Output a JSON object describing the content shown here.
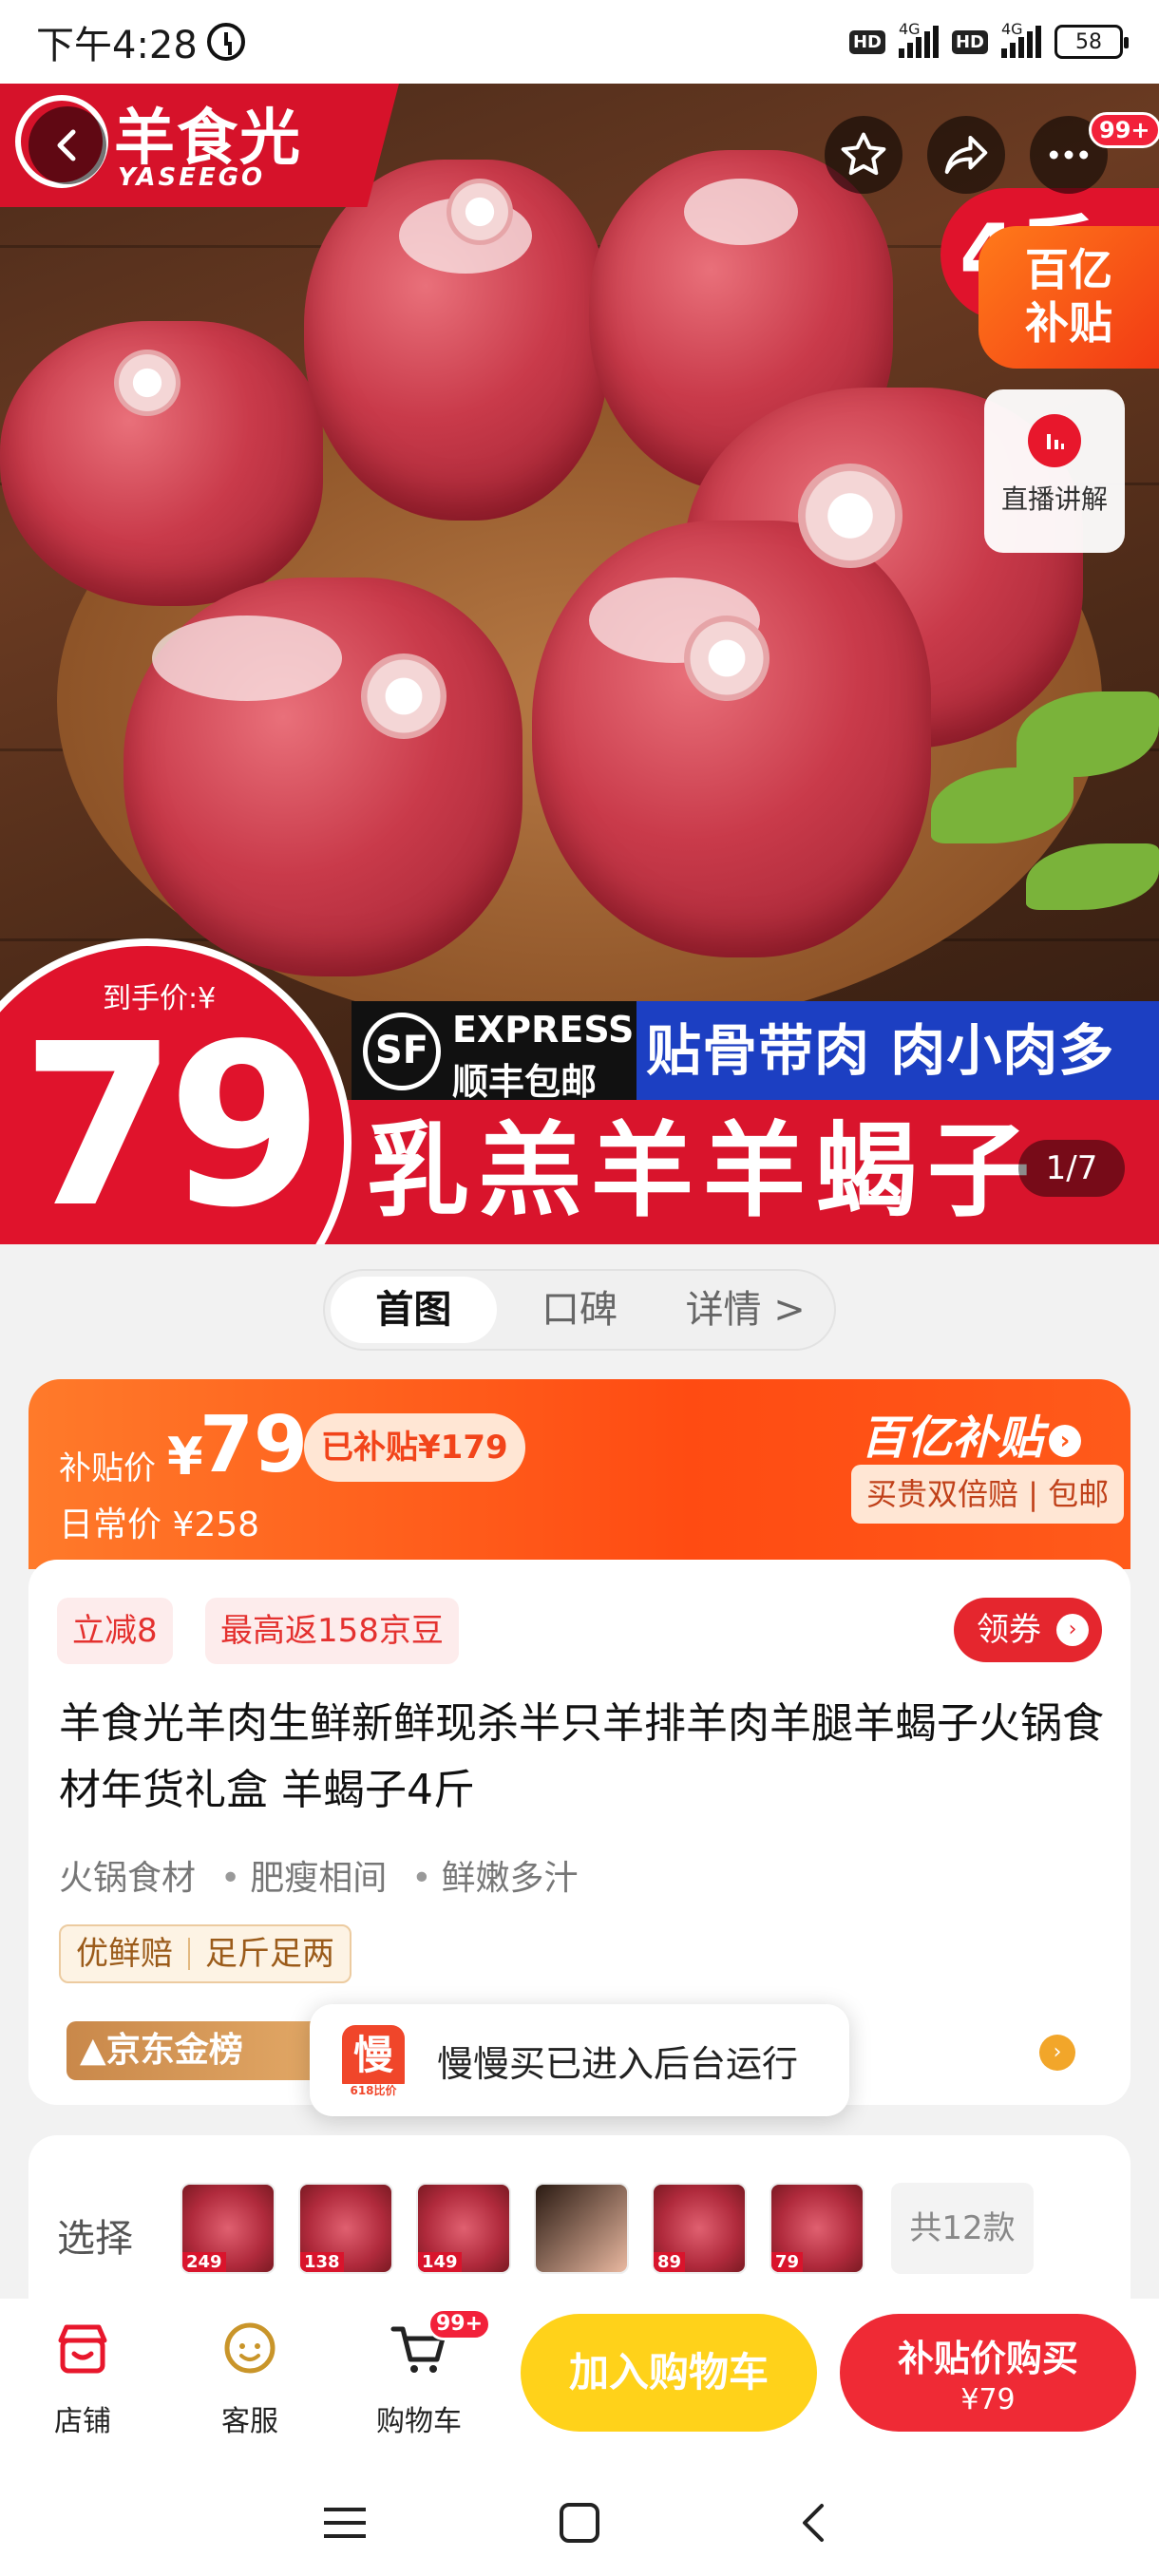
{
  "status_bar": {
    "time": "下午4:28",
    "battery": "58",
    "network1": "4G",
    "network2": "4G",
    "hd": "HD"
  },
  "hero": {
    "brand_name": "羊食光",
    "brand_en": "YASEEGO",
    "more_badge": "99+",
    "subsidy_line1": "百亿",
    "subsidy_line2": "补贴",
    "live_label": "直播讲解",
    "price_label": "到手价:¥",
    "price_big": "79",
    "sf_line1": "EXPRESS",
    "sf_line2": "顺丰包邮",
    "sf_logo": "SF",
    "blue_banner": "贴骨带肉 肉小肉多",
    "red_banner": "乳羔羊羊蝎子",
    "pager": "1/7",
    "corner_text": "4斤"
  },
  "tabs": [
    {
      "label": "首图",
      "active": true
    },
    {
      "label": "口碑",
      "active": false
    },
    {
      "label": "详情 >",
      "active": false
    }
  ],
  "price_card": {
    "subsidy_label": "补贴价",
    "currency": "¥",
    "subsidy_price": "79",
    "subsidized": "已补贴¥179",
    "daily_price": "日常价 ¥258",
    "subsidy_logo": "百亿补贴",
    "guarantee": "买贵双倍赔 | 包邮"
  },
  "info_card": {
    "chip_discount": "立减8",
    "chip_beans": "最高返158京豆",
    "coupon_label": "领券",
    "title": "羊食光羊肉生鲜新鲜现杀半只羊排羊肉羊腿羊蝎子火锅食材年货礼盒 羊蝎子4斤",
    "features": [
      "火锅食材",
      "肥瘦相间",
      "鲜嫩多汁"
    ],
    "guarantees": [
      "优鲜赔",
      "足斤足两"
    ],
    "jd_gold": "京东金榜"
  },
  "toast": {
    "app_icon": "慢",
    "app_sub": "618比价",
    "message": "慢慢买已进入后台运行"
  },
  "variant_card": {
    "label": "选择",
    "thumbs": [
      "249",
      "138",
      "149",
      "",
      "89",
      "79"
    ],
    "total": "共12款"
  },
  "bottom_bar": {
    "shop": "店铺",
    "service": "客服",
    "cart": "购物车",
    "cart_badge": "99+",
    "add_to_cart": "加入购物车",
    "buy_line1": "补贴价购买",
    "buy_line2": "¥79"
  },
  "colors": {
    "accent_red": "#e0132c",
    "subsidy_orange": "#ff5a1a",
    "cart_yellow": "#ffd21a",
    "buy_red": "#ef2a35"
  }
}
